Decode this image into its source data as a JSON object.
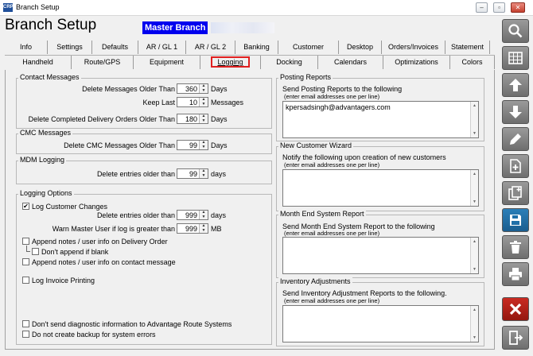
{
  "window": {
    "title": "Branch Setup",
    "logo_text": "CRP"
  },
  "header": {
    "title": "Branch Setup",
    "branch_name": "Master Branch"
  },
  "tabs_row1": [
    "Info",
    "Settings",
    "Defaults",
    "AR / GL 1",
    "AR / GL 2",
    "Banking",
    "Customer",
    "Desktop",
    "Orders/Invoices",
    "Statement"
  ],
  "tabs_row2": [
    "Handheld",
    "Route/GPS",
    "Equipment",
    "Logging",
    "Docking",
    "Calendars",
    "Optimizations",
    "Colors"
  ],
  "active_tab": "Logging",
  "contact_messages": {
    "title": "Contact Messages",
    "delete_older_label": "Delete Messages Older Than",
    "delete_older_value": "360",
    "delete_older_unit": "Days",
    "keep_last_label": "Keep Last",
    "keep_last_value": "10",
    "keep_last_unit": "Messages",
    "delete_completed_label": "Delete Completed Delivery Orders Older Than",
    "delete_completed_value": "180",
    "delete_completed_unit": "Days"
  },
  "cmc_messages": {
    "title": "CMC Messages",
    "delete_label": "Delete CMC Messages Older Than",
    "delete_value": "99",
    "delete_unit": "Days"
  },
  "mdm_logging": {
    "title": "MDM Logging",
    "delete_label": "Delete entries older than",
    "delete_value": "99",
    "delete_unit": "days"
  },
  "logging_options": {
    "title": "Logging Options",
    "log_customer_changes": "Log Customer Changes",
    "log_customer_changes_checked": true,
    "delete_label": "Delete entries older than",
    "delete_value": "999",
    "delete_unit": "days",
    "warn_label": "Warn Master User if log is greater than",
    "warn_value": "999",
    "warn_unit": "MB",
    "append_delivery": "Append notes / user info on Delivery Order",
    "dont_append_blank": "Don't append if blank",
    "append_contact": "Append notes / user info on contact message",
    "log_invoice": "Log Invoice Printing",
    "no_diagnostic": "Don't send diagnostic information to Advantage Route Systems",
    "no_backup": "Do not create backup for system errors"
  },
  "posting_reports": {
    "title": "Posting Reports",
    "desc": "Send Posting Reports to the following",
    "hint": "(enter email addresses one per line)",
    "emails": "kpersadsingh@advantagers.com"
  },
  "new_customer_wizard": {
    "title": "New Customer Wizard",
    "desc": "Notify the following upon creation of new customers",
    "hint": "(enter email addresses one per line)"
  },
  "month_end": {
    "title": "Month End System Report",
    "desc": "Send Month End System Report to the following",
    "hint": "(enter email addresses one per line)"
  },
  "inventory_adjustments": {
    "title": "Inventory Adjustments",
    "desc": "Send Inventory Adjustment Reports to the following.",
    "hint": "(enter email addresses one per line)"
  },
  "toolbar_icons": [
    "search-icon",
    "grid-icon",
    "arrow-up-icon",
    "arrow-down-icon",
    "pencil-icon",
    "new-document-icon",
    "copy-document-icon",
    "save-icon",
    "trash-icon",
    "print-icon",
    "close-icon",
    "exit-icon"
  ],
  "colors": {
    "accent": "#0000ee",
    "active_tab_border": "#e02020",
    "save_button": "#1f6fa8",
    "close_button": "#b3201a"
  }
}
